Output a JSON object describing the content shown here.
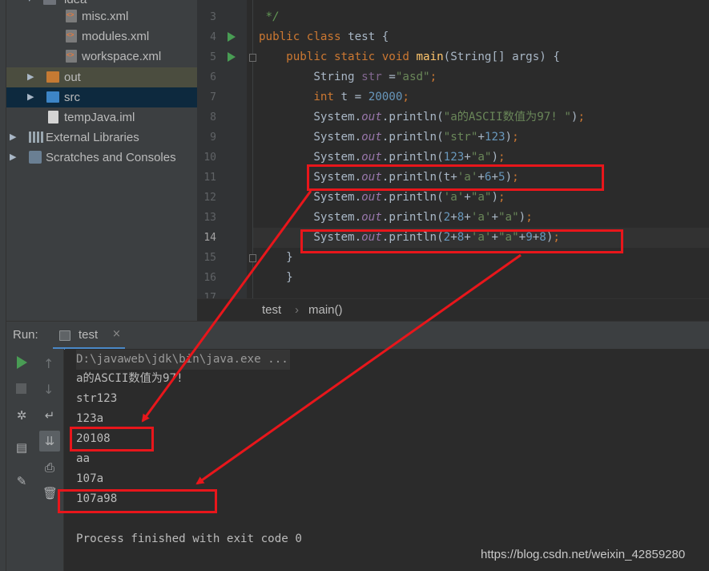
{
  "project_tree": {
    "items": [
      {
        "label": "misc.xml",
        "kind": "xml"
      },
      {
        "label": "modules.xml",
        "kind": "xml"
      },
      {
        "label": "workspace.xml",
        "kind": "xml"
      },
      {
        "label": "out",
        "kind": "folder",
        "expanded": false,
        "selected": "highlight"
      },
      {
        "label": "src",
        "kind": "folder",
        "expanded": false,
        "selected": "focus"
      },
      {
        "label": "tempJava.iml",
        "kind": "iml"
      },
      {
        "label": "External Libraries",
        "kind": "libraries",
        "expanded": false
      },
      {
        "label": "Scratches and Consoles",
        "kind": "scratches",
        "expanded": false
      }
    ],
    "partial_top_item": "idea"
  },
  "editor": {
    "current_line": 14,
    "lines": [
      {
        "num": "3",
        "text": " */"
      },
      {
        "num": "4",
        "text": "public class test {"
      },
      {
        "num": "5",
        "text": "    public static void main(String[] args) {"
      },
      {
        "num": "6",
        "text": "        String str =\"asd\";"
      },
      {
        "num": "7",
        "text": "        int t = 20000;"
      },
      {
        "num": "8",
        "text": "        System.out.println(\"a的ASCII数值为97! \");"
      },
      {
        "num": "9",
        "text": "        System.out.println(\"str\"+123);"
      },
      {
        "num": "10",
        "text": "        System.out.println(123+\"a\");"
      },
      {
        "num": "11",
        "text": "        System.out.println(t+'a'+6+5);"
      },
      {
        "num": "12",
        "text": "        System.out.println('a'+\"a\");"
      },
      {
        "num": "13",
        "text": "        System.out.println(2+8+'a'+\"a\");"
      },
      {
        "num": "14",
        "text": "        System.out.println(2+8+'a'+\"a\"+9+8);"
      },
      {
        "num": "15",
        "text": "    }"
      },
      {
        "num": "16",
        "text": "    }"
      },
      {
        "num": "17",
        "text": ""
      }
    ],
    "run_icons_on_lines": [
      "4",
      "5"
    ]
  },
  "breadcrumb": {
    "items": [
      "test",
      "main()"
    ],
    "separator": "›"
  },
  "run_panel": {
    "label": "Run:",
    "tab": {
      "label": "test",
      "close": "×"
    },
    "console": [
      "D:\\javaweb\\jdk\\bin\\java.exe ...",
      "a的ASCII数值为97!",
      "str123",
      "123a",
      "20108",
      "aa",
      "107a",
      "107a98",
      "",
      "Process finished with exit code 0"
    ]
  },
  "icons": {
    "run": "play-icon",
    "stop": "stop-icon",
    "up": "arrow-up-icon",
    "down": "arrow-down-icon",
    "wrap": "soft-wrap-icon",
    "scroll": "scroll-to-end-icon",
    "print": "print-icon",
    "trash": "trash-icon",
    "layout": "layout-icon",
    "pin": "pin-icon",
    "rerun": "rerun-icon"
  },
  "colors": {
    "annotation_red": "#e8161b",
    "keyword": "#cc7832",
    "string": "#6a8759",
    "number": "#6897bb",
    "field": "#9876aa",
    "run_green": "#499c54"
  },
  "watermark": "https://blog.csdn.net/weixin_42859280"
}
